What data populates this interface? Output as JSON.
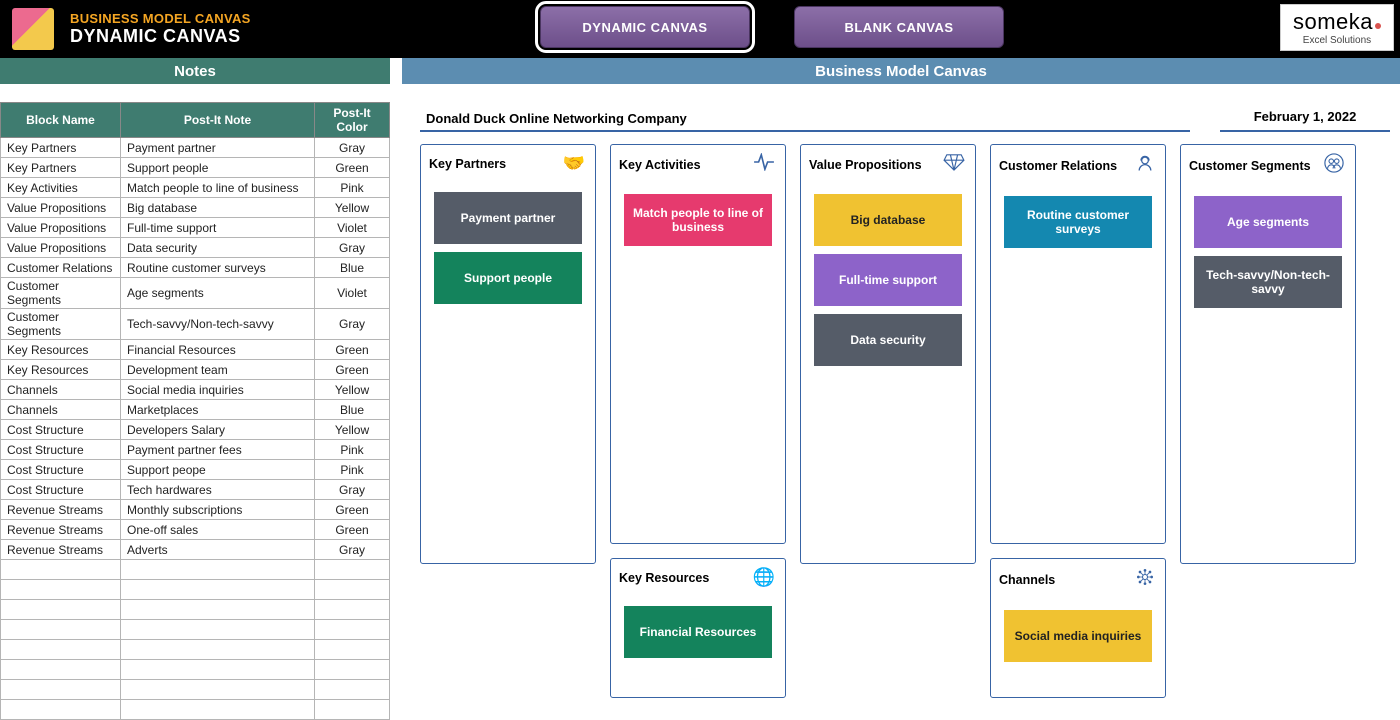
{
  "header": {
    "app_title": "BUSINESS MODEL CANVAS",
    "subtitle": "DYNAMIC CANVAS",
    "tab_dynamic": "DYNAMIC CANVAS",
    "tab_blank": "BLANK CANVAS",
    "brand_main": "someka",
    "brand_sub": "Excel Solutions"
  },
  "subheaders": {
    "left": "Notes",
    "right": "Business Model Canvas"
  },
  "notes": {
    "headers": [
      "Block Name",
      "Post-It Note",
      "Post-It Color"
    ],
    "rows": [
      {
        "block": "Key Partners",
        "note": "Payment partner",
        "color": "Gray"
      },
      {
        "block": "Key Partners",
        "note": "Support people",
        "color": "Green"
      },
      {
        "block": "Key Activities",
        "note": "Match people to line of business",
        "color": "Pink"
      },
      {
        "block": "Value Propositions",
        "note": "Big database",
        "color": "Yellow"
      },
      {
        "block": "Value Propositions",
        "note": "Full-time support",
        "color": "Violet"
      },
      {
        "block": "Value Propositions",
        "note": "Data security",
        "color": "Gray"
      },
      {
        "block": "Customer Relations",
        "note": "Routine customer surveys",
        "color": "Blue"
      },
      {
        "block": "Customer Segments",
        "note": "Age segments",
        "color": "Violet"
      },
      {
        "block": "Customer Segments",
        "note": "Tech-savvy/Non-tech-savvy",
        "color": "Gray"
      },
      {
        "block": "Key Resources",
        "note": "Financial Resources",
        "color": "Green"
      },
      {
        "block": "Key Resources",
        "note": "Development team",
        "color": "Green"
      },
      {
        "block": "Channels",
        "note": "Social media inquiries",
        "color": "Yellow"
      },
      {
        "block": "Channels",
        "note": "Marketplaces",
        "color": "Blue"
      },
      {
        "block": "Cost Structure",
        "note": "Developers Salary",
        "color": "Yellow"
      },
      {
        "block": "Cost Structure",
        "note": "Payment partner fees",
        "color": "Pink"
      },
      {
        "block": "Cost Structure",
        "note": "Support peope",
        "color": "Pink"
      },
      {
        "block": "Cost Structure",
        "note": "Tech hardwares",
        "color": "Gray"
      },
      {
        "block": "Revenue Streams",
        "note": "Monthly subscriptions",
        "color": "Green"
      },
      {
        "block": "Revenue Streams",
        "note": "One-off sales",
        "color": "Green"
      },
      {
        "block": "Revenue Streams",
        "note": "Adverts",
        "color": "Gray"
      },
      {
        "block": "",
        "note": "",
        "color": ""
      },
      {
        "block": "",
        "note": "",
        "color": ""
      },
      {
        "block": "",
        "note": "",
        "color": ""
      },
      {
        "block": "",
        "note": "",
        "color": ""
      },
      {
        "block": "",
        "note": "",
        "color": ""
      },
      {
        "block": "",
        "note": "",
        "color": ""
      },
      {
        "block": "",
        "note": "",
        "color": ""
      },
      {
        "block": "",
        "note": "",
        "color": ""
      }
    ]
  },
  "canvas": {
    "company": "Donald Duck Online Networking Company",
    "date": "February 1, 2022",
    "blocks": {
      "key_partners": {
        "title": "Key Partners",
        "icon": "handshake-icon",
        "postits": [
          {
            "text": "Payment partner",
            "color": "gray"
          },
          {
            "text": "Support people",
            "color": "green"
          }
        ]
      },
      "key_activities": {
        "title": "Key Activities",
        "icon": "pulse-icon",
        "postits": [
          {
            "text": "Match people to line of business",
            "color": "pink"
          }
        ]
      },
      "key_resources": {
        "title": "Key Resources",
        "icon": "globe-hand-icon",
        "postits": [
          {
            "text": "Financial Resources",
            "color": "green"
          }
        ]
      },
      "value_propositions": {
        "title": "Value Propositions",
        "icon": "diamond-icon",
        "postits": [
          {
            "text": "Big database",
            "color": "yellow"
          },
          {
            "text": "Full-time support",
            "color": "violet"
          },
          {
            "text": "Data security",
            "color": "gray"
          }
        ]
      },
      "customer_relations": {
        "title": "Customer Relations",
        "icon": "person-headset-icon",
        "postits": [
          {
            "text": "Routine customer surveys",
            "color": "blue"
          }
        ]
      },
      "channels": {
        "title": "Channels",
        "icon": "network-icon",
        "postits": [
          {
            "text": "Social media inquiries",
            "color": "yellow"
          }
        ]
      },
      "customer_segments": {
        "title": "Customer Segments",
        "icon": "people-icon",
        "postits": [
          {
            "text": "Age segments",
            "color": "violet"
          },
          {
            "text": "Tech-savvy/Non-tech-savvy",
            "color": "gray"
          }
        ]
      }
    }
  }
}
